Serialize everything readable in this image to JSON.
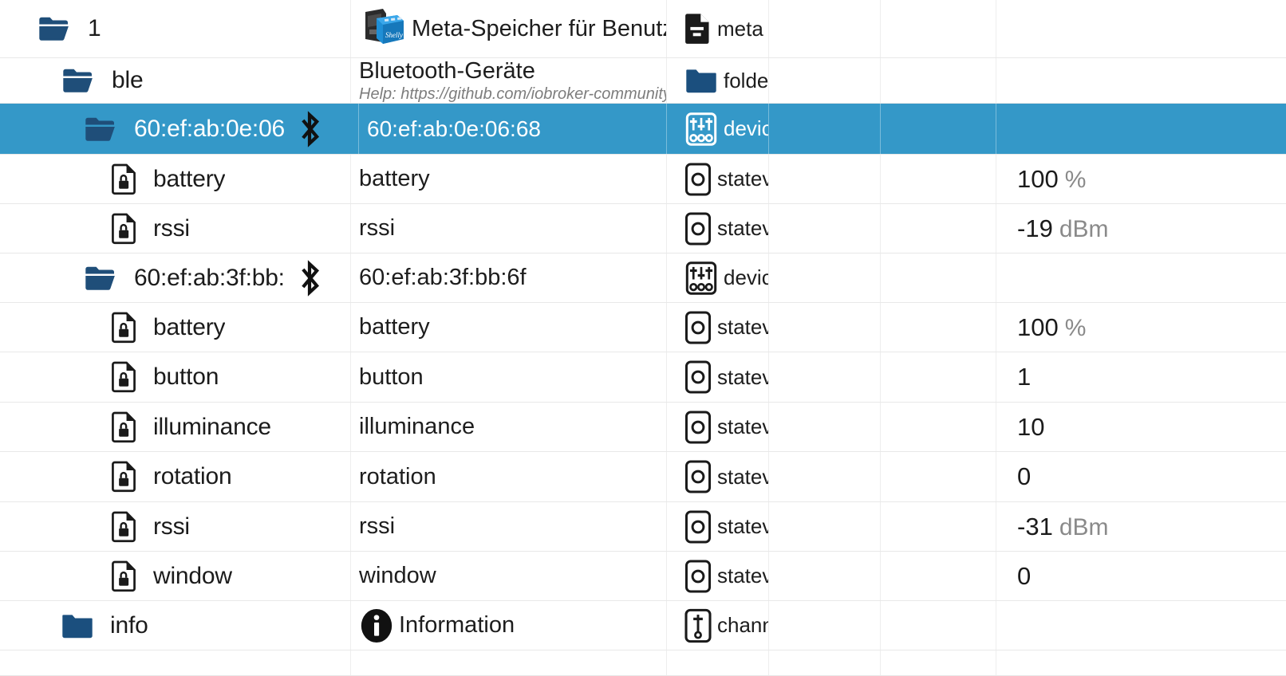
{
  "app": {
    "accent_selected": "#3498c8",
    "folder_open_color": "#1f4e79",
    "folder_closed_color": "#1b4f7e",
    "unit_color": "#8a8a8a"
  },
  "rows": [
    {
      "id": "row-1",
      "name": "1",
      "indent": 0,
      "name_icon": "folder-open-icon",
      "bt_icon": false,
      "desc": "Meta-Speicher für Benutzerdat...",
      "desc_help": "",
      "desc_img": "shelly-device-photo",
      "type": "meta",
      "type_icon": "file-meta-icon",
      "value": "",
      "unit": "",
      "selected": false
    },
    {
      "id": "row-ble",
      "name": "ble",
      "indent": 1,
      "name_icon": "folder-open-icon",
      "bt_icon": false,
      "desc": "Bluetooth-Geräte",
      "desc_help": "Help: https://github.com/iobroker-community",
      "desc_img": "",
      "type": "folder",
      "type_icon": "folder-filled-icon",
      "value": "",
      "unit": "",
      "selected": false
    },
    {
      "id": "row-dev-0e06",
      "name": "60:ef:ab:0e:06",
      "indent": 2,
      "name_icon": "folder-open-icon",
      "bt_icon": true,
      "desc": "60:ef:ab:0e:06:68",
      "desc_help": "",
      "desc_img": "",
      "type": "device",
      "type_icon": "device-sliders-icon",
      "value": "",
      "unit": "",
      "selected": true
    },
    {
      "id": "row-0e06-battery",
      "name": "battery",
      "indent": 3,
      "name_icon": "state-locked-icon",
      "bt_icon": false,
      "desc": "battery",
      "desc_help": "",
      "desc_img": "",
      "type": "statevalue",
      "type_icon": "state-circle-icon",
      "value": "100",
      "unit": "%",
      "selected": false
    },
    {
      "id": "row-0e06-rssi",
      "name": "rssi",
      "indent": 3,
      "name_icon": "state-locked-icon",
      "bt_icon": false,
      "desc": "rssi",
      "desc_help": "",
      "desc_img": "",
      "type": "statevalue",
      "type_icon": "state-circle-icon",
      "value": "-19",
      "unit": "dBm",
      "selected": false
    },
    {
      "id": "row-dev-3fbb",
      "name": "60:ef:ab:3f:bb:",
      "indent": 2,
      "name_icon": "folder-open-icon",
      "bt_icon": true,
      "desc": "60:ef:ab:3f:bb:6f",
      "desc_help": "",
      "desc_img": "",
      "type": "device",
      "type_icon": "device-sliders-icon",
      "value": "",
      "unit": "",
      "selected": false
    },
    {
      "id": "row-3fbb-battery",
      "name": "battery",
      "indent": 3,
      "name_icon": "state-locked-icon",
      "bt_icon": false,
      "desc": "battery",
      "desc_help": "",
      "desc_img": "",
      "type": "statevalue",
      "type_icon": "state-circle-icon",
      "value": "100",
      "unit": "%",
      "selected": false
    },
    {
      "id": "row-3fbb-button",
      "name": "button",
      "indent": 3,
      "name_icon": "state-locked-icon",
      "bt_icon": false,
      "desc": "button",
      "desc_help": "",
      "desc_img": "",
      "type": "statevalue",
      "type_icon": "state-circle-icon",
      "value": "1",
      "unit": "",
      "selected": false
    },
    {
      "id": "row-3fbb-illuminance",
      "name": "illuminance",
      "indent": 3,
      "name_icon": "state-locked-icon",
      "bt_icon": false,
      "desc": "illuminance",
      "desc_help": "",
      "desc_img": "",
      "type": "statevalue",
      "type_icon": "state-circle-icon",
      "value": "10",
      "unit": "",
      "selected": false
    },
    {
      "id": "row-3fbb-rotation",
      "name": "rotation",
      "indent": 3,
      "name_icon": "state-locked-icon",
      "bt_icon": false,
      "desc": "rotation",
      "desc_help": "",
      "desc_img": "",
      "type": "statevalue",
      "type_icon": "state-circle-icon",
      "value": "0",
      "unit": "",
      "selected": false
    },
    {
      "id": "row-3fbb-rssi",
      "name": "rssi",
      "indent": 3,
      "name_icon": "state-locked-icon",
      "bt_icon": false,
      "desc": "rssi",
      "desc_help": "",
      "desc_img": "",
      "type": "statevalue",
      "type_icon": "state-circle-icon",
      "value": "-31",
      "unit": "dBm",
      "selected": false
    },
    {
      "id": "row-3fbb-window",
      "name": "window",
      "indent": 3,
      "name_icon": "state-locked-icon",
      "bt_icon": false,
      "desc": "window",
      "desc_help": "",
      "desc_img": "",
      "type": "statevalue",
      "type_icon": "state-circle-icon",
      "value": "0",
      "unit": "",
      "selected": false
    },
    {
      "id": "row-info",
      "name": "info",
      "indent": 1,
      "name_icon": "folder-filled-icon",
      "bt_icon": false,
      "desc": "Information",
      "desc_help": "",
      "desc_img": "info-circle-icon",
      "type": "channel",
      "type_icon": "channel-icon",
      "value": "",
      "unit": "",
      "selected": false
    }
  ]
}
